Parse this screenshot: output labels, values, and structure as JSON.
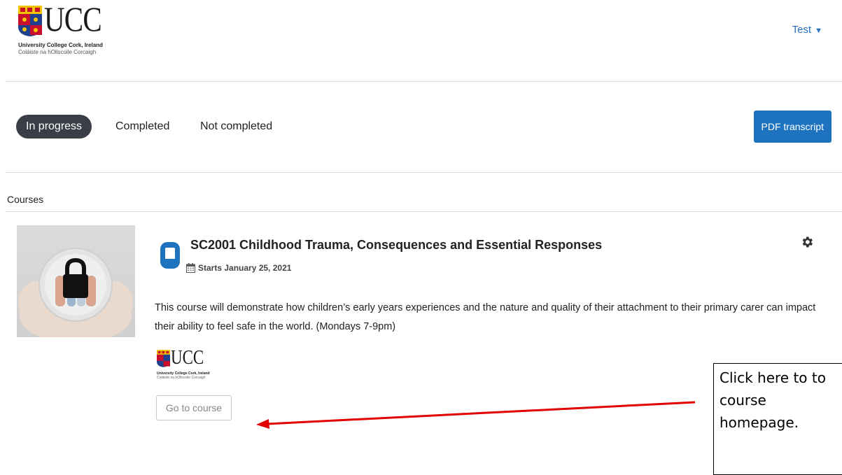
{
  "header": {
    "logo": {
      "wordmark": "UCC",
      "line1": "University College Cork, Ireland",
      "line2": "Coláiste na hOllscoile Corcaigh"
    },
    "user": {
      "name": "Test",
      "caret": "▼"
    }
  },
  "tabs": [
    {
      "label": "In progress",
      "active": true
    },
    {
      "label": "Completed",
      "active": false
    },
    {
      "label": "Not completed",
      "active": false
    }
  ],
  "pdf_transcript_label": "PDF transcript",
  "section_title": "Courses",
  "course": {
    "title": "SC2001 Childhood Trauma, Consequences and Essential Responses",
    "start": "Starts January 25, 2021",
    "description": "This course will demonstrate how children’s early years experiences and the nature and quality of their attachment to their primary carer can impact their ability to feel safe in the world. (Mondays 7-9pm)",
    "logo": {
      "wordmark": "UCC",
      "line1": "University College Cork, Ireland",
      "line2": "Coláiste na hOllscoile Corcaigh"
    },
    "go_label": "Go to course"
  },
  "annotation": {
    "text": "Click here to to course homepage."
  },
  "colors": {
    "accent": "#1e73be",
    "link": "#2573c0",
    "active_tab": "#3a3f47",
    "arrow": "#e00000"
  },
  "icons": [
    "ucc-crest-icon",
    "caret-down-icon",
    "course-tablet-icon",
    "calendar-icon",
    "gear-icon"
  ]
}
